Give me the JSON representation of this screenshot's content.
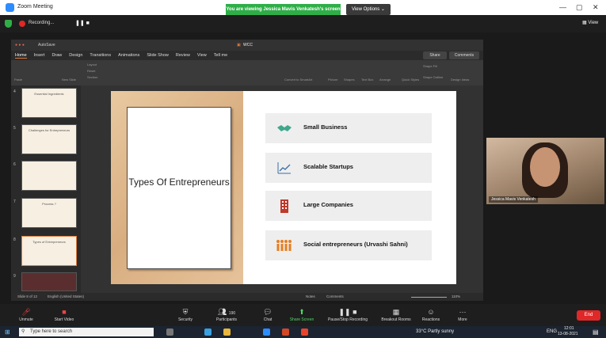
{
  "zoom": {
    "window_title": "Zoom Meeting",
    "share_banner": "You are viewing Jessica Mavis Venkatesh's screen",
    "view_options": "View Options",
    "recording_label": "Recording...",
    "view_label": "View"
  },
  "ppt": {
    "filename": "WCC",
    "autosave": "AutoSave",
    "tabs": [
      "Home",
      "Insert",
      "Draw",
      "Design",
      "Transitions",
      "Animations",
      "Slide Show",
      "Review",
      "View",
      "Tell me"
    ],
    "share": "Share",
    "comments": "Comments",
    "ribbon_labels": [
      "Paste",
      "New Slide",
      "Layout",
      "Reset",
      "Section",
      "Convert to SmartArt",
      "Picture",
      "Shapes",
      "Text Box",
      "Arrange",
      "Quick Styles",
      "Shape Fill",
      "Shape Outline",
      "Design Ideas"
    ],
    "thumbnail_numbers": [
      "4",
      "5",
      "6",
      "7",
      "8",
      "9"
    ],
    "thumbnail_titles": [
      "Essential Ingredients",
      "Challenges for Entrepreneurs",
      "",
      "Process ?",
      "Types of Entrepreneurs",
      ""
    ],
    "status_left": "Slide 8 of 12",
    "status_lang": "English (United States)",
    "status_notes": "Notes",
    "status_comments": "Comments",
    "zoom_level": "110%"
  },
  "slide": {
    "title": "Types Of Entrepreneurs",
    "items": [
      {
        "label": "Small Business",
        "icon": "handshake-icon",
        "color": "#3fa88c"
      },
      {
        "label": "Scalable Startups",
        "icon": "line-chart-icon",
        "color": "#3a6ea5"
      },
      {
        "label": "Large Companies",
        "icon": "building-icon",
        "color": "#c0392b"
      },
      {
        "label": "Social entrepreneurs (Urvashi Sahni)",
        "icon": "people-icon",
        "color": "#e67e22"
      }
    ]
  },
  "video": {
    "participant_name": "Jessica Mavis Venkatesh"
  },
  "controls": {
    "unmute": "Unmute",
    "start_video": "Start Video",
    "security": "Security",
    "participants": "Participants",
    "participants_count": "190",
    "chat": "Chat",
    "share_screen": "Share Screen",
    "pause_recording": "Pause/Stop Recording",
    "breakout": "Breakout Rooms",
    "reactions": "Reactions",
    "more": "More",
    "end": "End"
  },
  "taskbar": {
    "search_placeholder": "Type here to search",
    "weather": "33°C  Partly sunny",
    "language": "ENG",
    "time": "12:01",
    "date": "13-08-2021"
  }
}
